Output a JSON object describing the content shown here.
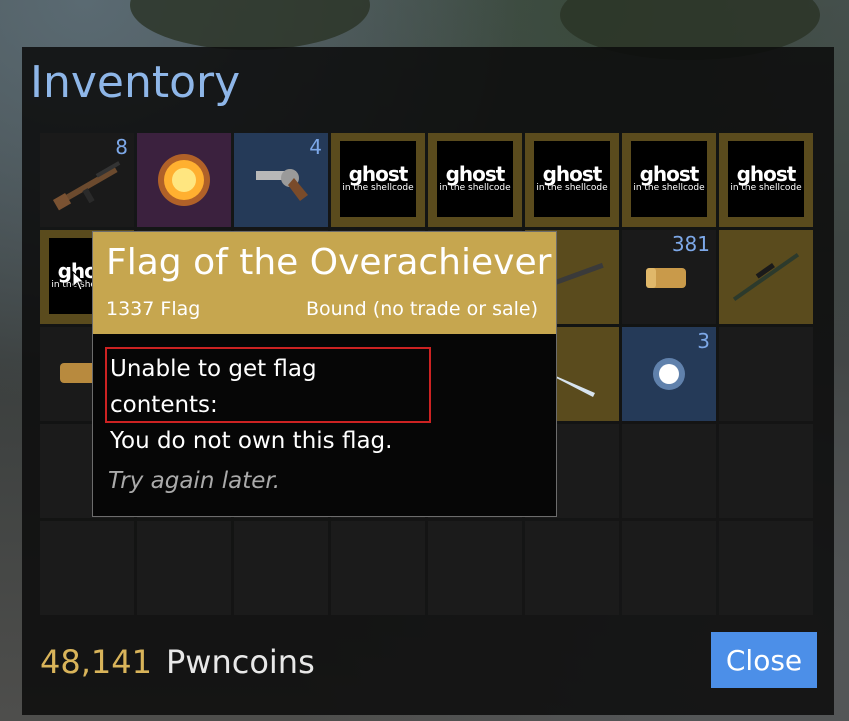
{
  "inventory": {
    "title": "Inventory",
    "row1": [
      {
        "kind": "rifle",
        "count": "8"
      },
      {
        "kind": "fire",
        "count": ""
      },
      {
        "kind": "revolver",
        "count": "4"
      },
      {
        "kind": "ghost",
        "count": ""
      },
      {
        "kind": "ghost",
        "count": ""
      },
      {
        "kind": "ghost",
        "count": ""
      },
      {
        "kind": "ghost",
        "count": ""
      },
      {
        "kind": "ghost",
        "count": ""
      }
    ],
    "row2_visible": [
      {
        "kind": "bullet",
        "count": "381"
      },
      {
        "kind": "sniper",
        "count": ""
      }
    ],
    "row3_visible": [
      {
        "kind": "orb",
        "count": "3"
      }
    ],
    "ghost_logo": {
      "word": "ghost",
      "sub": "in the shellcode"
    }
  },
  "tooltip": {
    "title": "Flag of the Overachiever",
    "type": "1337 Flag",
    "bound": "Bound (no trade or sale)",
    "error_line1": "Unable to get flag contents:",
    "error_line2": "You do not own this flag.",
    "retry": "Try again later."
  },
  "footer": {
    "coins_value": "48,141",
    "coins_label": "Pwncoins",
    "close_label": "Close"
  },
  "colors": {
    "title": "#8eb6e8",
    "gold": "#c6a64f",
    "accent": "#4c8fe8",
    "error_border": "#cc2222"
  }
}
